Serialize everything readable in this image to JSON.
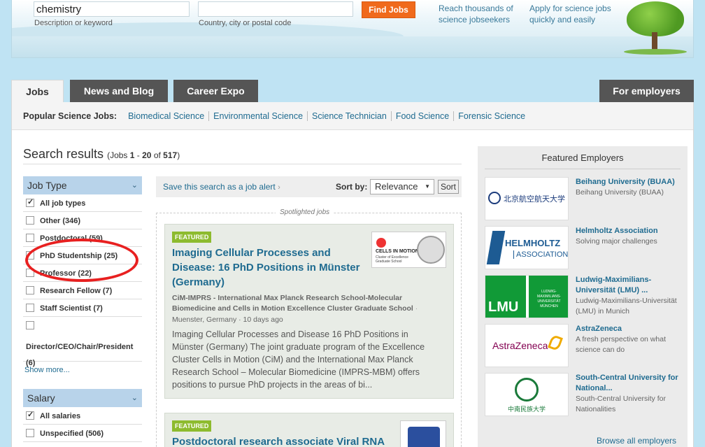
{
  "search": {
    "keyword_value": "chemistry",
    "keyword_label": "Description or keyword",
    "location_value": "",
    "location_label": "Country, city or postal code",
    "button": "Find Jobs"
  },
  "promo": {
    "left_line1": "Reach thousands of",
    "left_line2": "science jobseekers",
    "right_line1": "Apply for science jobs",
    "right_line2": "quickly and easily"
  },
  "tabs": [
    "Jobs",
    "News and Blog",
    "Career Expo"
  ],
  "employers_tab": "For employers",
  "popular": {
    "label": "Popular Science Jobs:",
    "links": [
      "Biomedical Science",
      "Environmental Science",
      "Science Technician",
      "Food Science",
      "Forensic Science"
    ]
  },
  "results": {
    "title": "Search results",
    "count_open": "(Jobs ",
    "start": "1",
    "dash": " - ",
    "end": "20",
    "of": " of ",
    "total": "517",
    "count_close": ")"
  },
  "job_type": {
    "header": "Job Type",
    "items": [
      {
        "label": "All job types",
        "checked": true
      },
      {
        "label": "Other (346)",
        "checked": false
      },
      {
        "label": "Postdoctoral (59)",
        "checked": false
      },
      {
        "label": "PhD Studentship (25)",
        "checked": false
      },
      {
        "label": "Professor (22)",
        "checked": false
      },
      {
        "label": "Research Fellow (7)",
        "checked": false
      },
      {
        "label": "Staff Scientist (7)",
        "checked": false
      },
      {
        "label": "Director/CEO/Chair/President (6)",
        "checked": false
      }
    ],
    "show_more": "Show more..."
  },
  "salary": {
    "header": "Salary",
    "items": [
      {
        "label": "All salaries",
        "checked": true
      },
      {
        "label": "Unspecified (506)",
        "checked": false
      }
    ]
  },
  "toolbar": {
    "save_alert": "Save this search as a job alert",
    "sort_label": "Sort by:",
    "sort_value": "Relevance",
    "sort_button": "Sort"
  },
  "spotlight_label": "Spotlighted jobs",
  "jobs": [
    {
      "badge": "FEATURED",
      "title": "Imaging Cellular Processes and Disease: 16 PhD Positions in Münster (Germany)",
      "org": "CiM-IMPRS - International Max Planck Research School-Molecular Biomedicine and Cells in Motion Excellence Cluster Graduate School",
      "location": "Muenster, Germany",
      "age": "10 days ago",
      "description": "Imaging Cellular Processes and Disease 16 PhD Positions in Münster (Germany) The joint graduate program of the Excellence Cluster Cells in Motion (CiM) and the International Max Planck Research School – Molecular Biomedicine (IMPRS-MBM) offers positions to pursue PhD projects in the areas of bi...",
      "logo_title": "CELLS IN MOTION",
      "logo_sub": "Cluster of Excellence Graduate School"
    },
    {
      "badge": "FEATURED",
      "title": "Postdoctoral research associate Viral RNA"
    }
  ],
  "featured": {
    "title": "Featured Employers",
    "employers": [
      {
        "name": "Beihang University (BUAA)",
        "desc": "Beihang University (BUAA)",
        "logo_text": "北京航空航天大学"
      },
      {
        "name": "Helmholtz Association",
        "desc": "Solving major challenges",
        "logo_line1": "HELMHOLTZ",
        "logo_line2": "ASSOCIATION"
      },
      {
        "name": "Ludwig-Maximilians-Universität (LMU) ...",
        "desc": "Ludwig-Maximilians-Universität (LMU) in Munich",
        "logo_text": "LMU",
        "logo_sub": "LUDWIG-MAXIMILIANS-UNIVERSITÄT MÜNCHEN"
      },
      {
        "name": "AstraZeneca",
        "desc": "A fresh perspective on what science can do",
        "logo_text": "AstraZeneca"
      },
      {
        "name": "South-Central University for National...",
        "desc": "South-Central University for Nationalities",
        "logo_text": "中南民族大学"
      }
    ],
    "browse": "Browse all employers"
  },
  "colors": {
    "accent": "#f06a1c",
    "link": "#1f6b90",
    "featured_badge": "#8dbb2e",
    "facet_header": "#b8d3ea",
    "annotation": "#e82020"
  }
}
